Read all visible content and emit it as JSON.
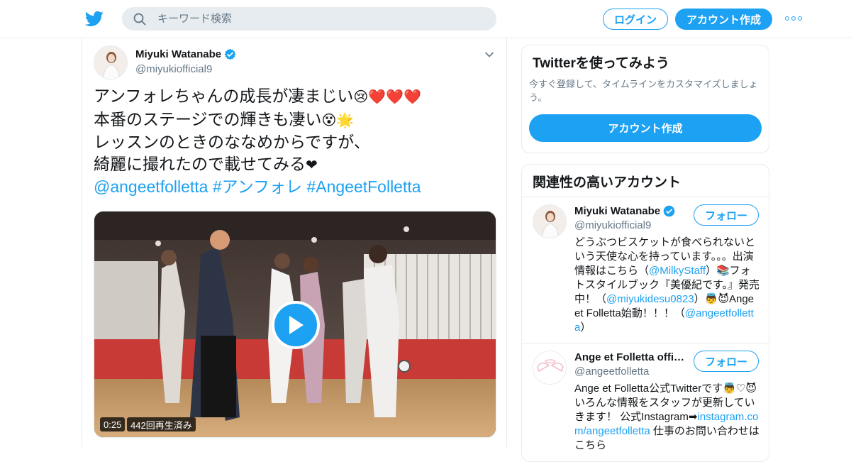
{
  "colors": {
    "accent": "#1da1f2",
    "text": "#14171a",
    "muted": "#657786",
    "border": "#e6ecf0"
  },
  "header": {
    "search_placeholder": "キーワード検索",
    "login_label": "ログイン",
    "signup_label": "アカウント作成"
  },
  "tweet": {
    "author_name": "Miyuki Watanabe",
    "author_handle": "@miyukiofficial9",
    "lines": [
      "アンフォレちゃんの成長が凄まじい",
      "本番のステージでの輝きも凄い",
      "レッスンのときのななめからですが、",
      "綺麗に撮れたので載せてみる"
    ],
    "line_emojis": [
      "😢❤️❤️❤️",
      "😵🌟",
      "",
      "❤"
    ],
    "mention": "@angeetfolletta",
    "hashtag1": "#アンフォレ",
    "hashtag2": "#AngeetFolletta",
    "video_time": "0:25",
    "video_views": "442回再生済み"
  },
  "sidebar": {
    "signup_card": {
      "title": "Twitterを使ってみよう",
      "description": "今すぐ登録して、タイムラインをカスタマイズしましょう。",
      "button_label": "アカウント作成"
    },
    "related": {
      "title": "関連性の高いアカウント",
      "accounts": [
        {
          "name": "Miyuki Watanabe",
          "handle": "@miyukiofficial9",
          "follow_label": "フォロー",
          "verified": true,
          "bio_parts": {
            "p1": "どうぶつビスケットが食べられないという天使な心を持っています。。。出演情報はこちら（",
            "link1": "@MilkyStaff",
            "p2": "）📚フォトスタイルブック『美優紀です。』発売中！（",
            "link2": "@miyukidesu0823",
            "p3": "）👼😈Ange et Folletta始動！！！（",
            "link3": "@angeetfolletta",
            "p4": "）"
          }
        },
        {
          "name": "Ange et Folletta offi…",
          "handle": "@angeetfolletta",
          "follow_label": "フォロー",
          "verified": false,
          "bio_parts": {
            "p1": "Ange et Folletta公式Twitterです👼♡😈 いろんな情報をスタッフが更新していきます！ 公式Instagram➡",
            "link1": "instagram.com/angeetfolletta",
            "p2": " 仕事のお問い合わせはこちら"
          }
        }
      ]
    }
  }
}
